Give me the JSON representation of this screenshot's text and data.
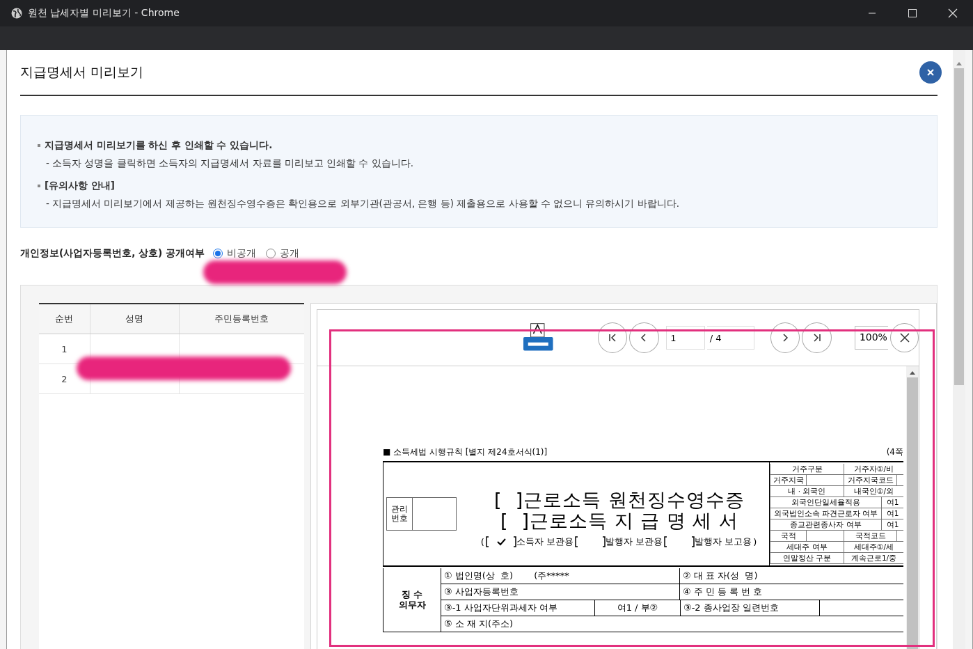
{
  "window": {
    "title": "원천 납세자별 미리보기 - Chrome"
  },
  "dialog": {
    "title": "지급명세서 미리보기"
  },
  "notice": [
    {
      "kind": "bullet",
      "text": "지급명세서 미리보기를 하신 후 인쇄할 수 있습니다."
    },
    {
      "kind": "dash",
      "text": "- 소득자 성명을 클릭하면 소득자의 지급명세서 자료를 미리보고 인쇄할 수 있습니다."
    },
    {
      "kind": "bullet",
      "text": "[유의사항 안내]"
    },
    {
      "kind": "dash",
      "text": "- 지급명세서 미리보기에서 제공하는 원천징수영수증은 확인용으로 외부기관(관공서, 은행 등) 제출용으로 사용할 수 없으니 유의하시기 바랍니다."
    }
  ],
  "privacy": {
    "label": "개인정보(사업자등록번호, 상호) 공개여부",
    "options": [
      {
        "label": "비공개",
        "selected": true
      },
      {
        "label": "공개",
        "selected": false
      }
    ]
  },
  "recipients": {
    "columns": [
      "순번",
      "성명",
      "주민등록번호"
    ],
    "rows": [
      {
        "no": "1"
      },
      {
        "no": "2"
      }
    ]
  },
  "viewer": {
    "page": "1",
    "total": "/ 4",
    "zoom": "100%"
  },
  "document": {
    "form_title": "■ 소득세법 시행규칙 [별지 제24호서식(1)]",
    "page_note": "(4쪽",
    "manage_label": "관리 번호",
    "titles": [
      "[  ]근로소득 원천징수영수증",
      "[  ]근로소득 지 급 명 세 서"
    ],
    "copies": {
      "open": "(",
      "close": ")",
      "items": [
        {
          "label": "소득자 보관용",
          "checked": true
        },
        {
          "label": "발행자 보관용",
          "checked": false
        },
        {
          "label": "발행자 보고용",
          "checked": false
        }
      ]
    },
    "side_rows": [
      {
        "kind": "pair",
        "label": "거주구분",
        "value": "거주자①/비"
      },
      {
        "kind": "quad",
        "label": "거주지국",
        "label2": "거주지국코드"
      },
      {
        "kind": "pair",
        "label": "내 · 외국인",
        "value": "내국인①/외"
      },
      {
        "kind": "wide",
        "label": "외국인단일세율적용",
        "value": "여1"
      },
      {
        "kind": "wide",
        "label": "외국법인소속 파견근로자 여부",
        "value": "여1"
      },
      {
        "kind": "wide",
        "label": "종교관련종사자 여부",
        "value": "여1"
      },
      {
        "kind": "quad",
        "label": "국적",
        "label2": "국적코드"
      },
      {
        "kind": "pair",
        "label": "세대주 여부",
        "value": "세대주①/세"
      },
      {
        "kind": "pair",
        "label": "연말정산 구분",
        "value": "계속근로1/중"
      }
    ],
    "payer": {
      "label": "징 수 의무자",
      "rows": [
        {
          "kind": "inline",
          "left": "① 법인명(상  호)",
          "left_value": "(주*****",
          "right": "② 대 표 자(성  명)"
        },
        {
          "kind": "plain",
          "left": "③ 사업자등록번호",
          "right": "④ 주 민 등 록 번 호"
        },
        {
          "kind": "split",
          "left": "③-1 사업자단위과세자 여부",
          "left_value": "여1 / 부②",
          "right": "③-2 종사업장 일련번호"
        },
        {
          "kind": "full",
          "left": "⑤ 소 재 지(주소)"
        }
      ]
    }
  }
}
